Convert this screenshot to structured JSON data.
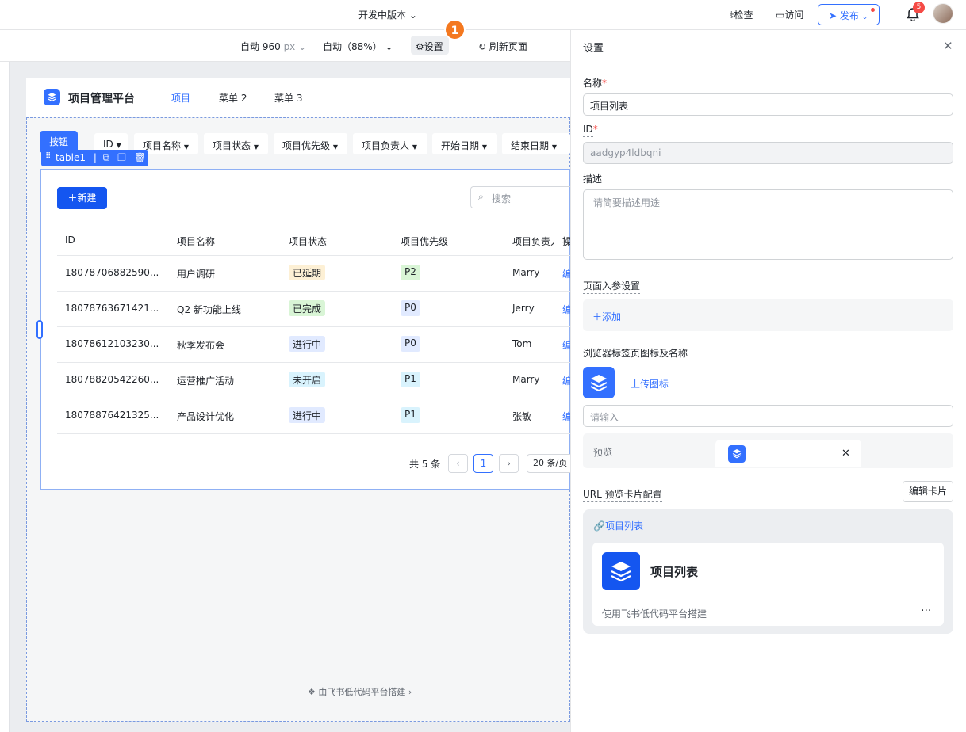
{
  "topbar": {
    "version": "开发中版本",
    "inspect": "检查",
    "visit": "访问",
    "publish": "发布",
    "notif_count": "5"
  },
  "toolbar": {
    "width": "自动 960",
    "width_unit": "px",
    "zoom": "自动（88%）",
    "settings": "设置",
    "refresh": "刷新页面",
    "step": "1"
  },
  "app": {
    "title": "项目管理平台",
    "nav": [
      "项目",
      "菜单 2",
      "菜单 3"
    ],
    "button": "按钮",
    "filters": [
      "ID",
      "项目名称",
      "项目状态",
      "项目优先级",
      "项目负责人",
      "开始日期",
      "结束日期"
    ],
    "component_tag": "table1",
    "new_button": "新建",
    "search_placeholder": "搜索",
    "columns": [
      "ID",
      "项目名称",
      "项目状态",
      "项目优先级",
      "项目负责人",
      "操"
    ],
    "rows": [
      {
        "id": "18078706882590...",
        "name": "用户调研",
        "status": "已延期",
        "priority": "P2",
        "owner": "Marry",
        "op": "编"
      },
      {
        "id": "18078763671421...",
        "name": "Q2 新功能上线",
        "status": "已完成",
        "priority": "P0",
        "owner": "Jerry",
        "op": "编"
      },
      {
        "id": "18078612103230...",
        "name": "秋季发布会",
        "status": "进行中",
        "priority": "P0",
        "owner": "Tom",
        "op": "编"
      },
      {
        "id": "18078820542260...",
        "name": "运营推广活动",
        "status": "未开启",
        "priority": "P1",
        "owner": "Marry",
        "op": "编"
      },
      {
        "id": "18078876421325...",
        "name": "产品设计优化",
        "status": "进行中",
        "priority": "P1",
        "owner": "张敏",
        "op": "编"
      }
    ],
    "total": "共 5 条",
    "page": "1",
    "page_size": "20 条/页",
    "footer": "由飞书低代码平台搭建"
  },
  "settings": {
    "title": "设置",
    "name_label": "名称",
    "name_value": "项目列表",
    "id_label": "ID",
    "id_value": "aadgyp4ldbqni",
    "desc_label": "描述",
    "desc_placeholder": "请简要描述用途",
    "params_label": "页面入参设置",
    "add": "添加",
    "tab_label": "浏览器标签页图标及名称",
    "upload": "上传图标",
    "input_placeholder": "请输入",
    "preview": "预览",
    "url_label": "URL 预览卡片配置",
    "edit_card": "编辑卡片",
    "link_text": "项目列表",
    "card_title": "项目列表",
    "card_desc": "使用飞书低代码平台搭建",
    "more": "···"
  },
  "status_colors": {
    "已延期": "#fdf0d5",
    "已完成": "#d9f5d6",
    "进行中": "#e1eaff",
    "未开启": "#d9f3fd"
  },
  "accent": "#3370ff"
}
